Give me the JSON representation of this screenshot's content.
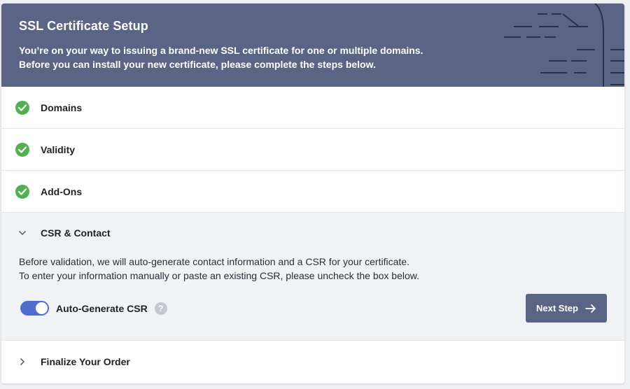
{
  "header": {
    "title": "SSL Certificate Setup",
    "subtitle_line1": "You’re on your way to issuing a brand-new SSL certificate for one or multiple domains.",
    "subtitle_line2": "Before you can install your new certificate, please complete the steps below."
  },
  "steps": [
    {
      "label": "Domains",
      "status": "complete",
      "icon": "check-icon"
    },
    {
      "label": "Validity",
      "status": "complete",
      "icon": "check-icon"
    },
    {
      "label": "Add-Ons",
      "status": "complete",
      "icon": "check-icon"
    },
    {
      "label": "CSR & Contact",
      "status": "expanded",
      "icon": "chevron-down-icon"
    },
    {
      "label": "Finalize Your Order",
      "status": "collapsed",
      "icon": "chevron-right-icon"
    }
  ],
  "csr": {
    "desc_line1": "Before validation, we will auto-generate contact information and a CSR for your certificate.",
    "desc_line2": "To enter your information manually or paste an existing CSR, please uncheck the box below.",
    "toggle_label": "Auto-Generate CSR",
    "toggle_on": true,
    "help_symbol": "?",
    "next_button": "Next Step"
  },
  "colors": {
    "header_bg": "#5a6585",
    "check_green": "#52b14f",
    "toggle_blue": "#4f6fcf",
    "button_bg": "#5a6585"
  }
}
